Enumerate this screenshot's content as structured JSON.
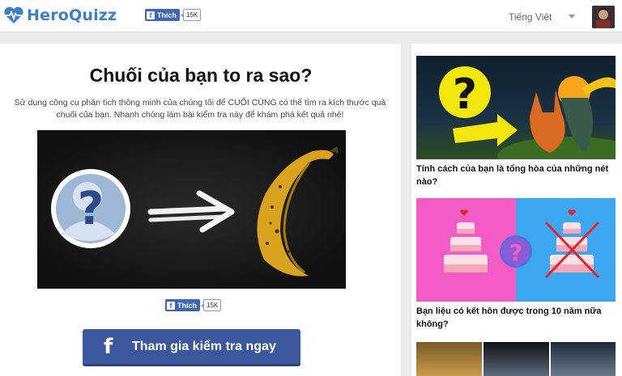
{
  "header": {
    "logo_text": "HeroQuizz",
    "like_label": "Thích",
    "like_count": "15K",
    "language": "Tiếng Việt"
  },
  "quiz": {
    "title": "Chuối của bạn to ra sao?",
    "description": "Sử dụng công cụ phân tích thông minh của chúng tôi để CUỐI CÙNG có thể tìm ra kích thước quả chuối của bạn. Nhanh chóng làm bài kiểm tra này để khám phá kết quả nhé!",
    "like_label": "Thích",
    "like_count": "15K",
    "start_button": "Tham gia kiểm tra ngay"
  },
  "sidebar": {
    "items": [
      {
        "title": "Tính cách của bạn là tổng hòa của những nét nào?"
      },
      {
        "title": "Bạn liệu có kết hôn được trong 10 năm nữa không?"
      }
    ]
  },
  "colors": {
    "brand": "#3b7fc4",
    "facebook": "#3b579d",
    "pink": "#f25cc4",
    "blue": "#3da7f2"
  }
}
